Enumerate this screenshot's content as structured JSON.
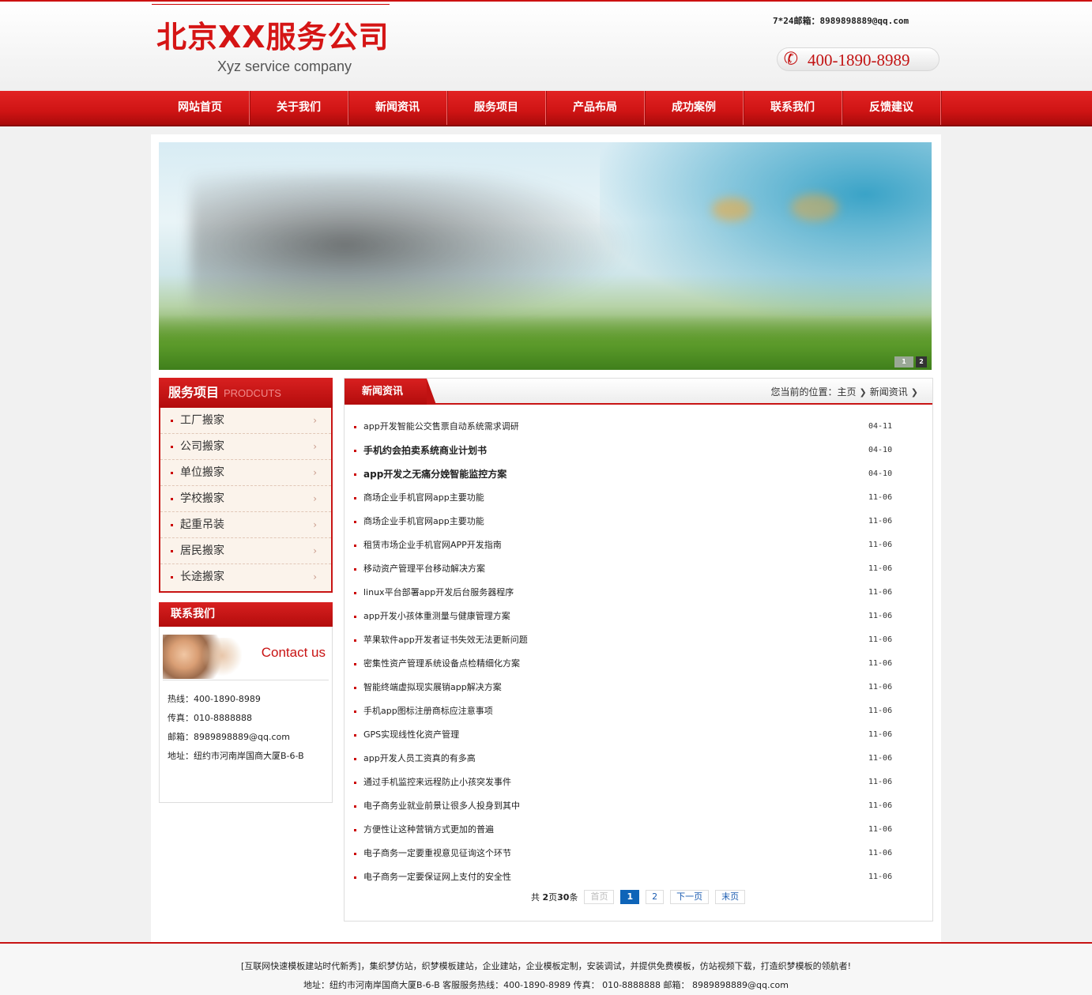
{
  "header": {
    "logo_cn": "北京XX服务公司",
    "logo_en": "Xyz service company",
    "top_email": "7*24邮箱：8989898889@qq.com",
    "phone": "400-1890-8989"
  },
  "nav": {
    "items": [
      "网站首页",
      "关于我们",
      "新闻资讯",
      "服务项目",
      "产品布局",
      "成功案例",
      "联系我们",
      "反馈建议"
    ]
  },
  "banner": {
    "dots": [
      "1",
      "2"
    ]
  },
  "sidebar": {
    "title_cn": "服务项目",
    "title_en": "PRODCUTS",
    "items": [
      "工厂搬家",
      "公司搬家",
      "单位搬家",
      "学校搬家",
      "起重吊装",
      "居民搬家",
      "长途搬家"
    ]
  },
  "contact": {
    "title": "联系我们",
    "image_text": "Contact us",
    "lines": [
      "热线：400-1890-8989",
      "传真：010-8888888",
      "邮箱：8989898889@qq.com",
      "地址：纽约市河南岸国商大厦B-6-B"
    ]
  },
  "news": {
    "tab": "新闻资讯",
    "breadcrumb_prefix": "您当前的位置：",
    "breadcrumb_home": "主页",
    "breadcrumb_current": "新闻资讯",
    "items": [
      {
        "title": "app开发智能公交售票自动系统需求调研",
        "date": "04-11",
        "bold": false
      },
      {
        "title": "手机约会拍卖系统商业计划书",
        "date": "04-10",
        "bold": true
      },
      {
        "title": "app开发之无痛分娩智能监控方案",
        "date": "04-10",
        "bold": true
      },
      {
        "title": "商场企业手机官网app主要功能",
        "date": "11-06",
        "bold": false
      },
      {
        "title": "商场企业手机官网app主要功能",
        "date": "11-06",
        "bold": false
      },
      {
        "title": "租赁市场企业手机官网APP开发指南",
        "date": "11-06",
        "bold": false
      },
      {
        "title": "移动资产管理平台移动解决方案",
        "date": "11-06",
        "bold": false
      },
      {
        "title": "linux平台部署app开发后台服务器程序",
        "date": "11-06",
        "bold": false
      },
      {
        "title": "app开发小孩体重测量与健康管理方案",
        "date": "11-06",
        "bold": false
      },
      {
        "title": "苹果软件app开发者证书失效无法更新问题",
        "date": "11-06",
        "bold": false
      },
      {
        "title": "密集性资产管理系统设备点检精细化方案",
        "date": "11-06",
        "bold": false
      },
      {
        "title": "智能终端虚拟现实展销app解决方案",
        "date": "11-06",
        "bold": false
      },
      {
        "title": "手机app图标注册商标应注意事项",
        "date": "11-06",
        "bold": false
      },
      {
        "title": "GPS实现线性化资产管理",
        "date": "11-06",
        "bold": false
      },
      {
        "title": "app开发人员工资真的有多高",
        "date": "11-06",
        "bold": false
      },
      {
        "title": "通过手机监控来远程防止小孩突发事件",
        "date": "11-06",
        "bold": false
      },
      {
        "title": "电子商务业就业前景让很多人投身到其中",
        "date": "11-06",
        "bold": false
      },
      {
        "title": "方便性让这种营销方式更加的普遍",
        "date": "11-06",
        "bold": false
      },
      {
        "title": "电子商务一定要重视意见征询这个环节",
        "date": "11-06",
        "bold": false
      },
      {
        "title": "电子商务一定要保证网上支付的安全性",
        "date": "11-06",
        "bold": false
      }
    ]
  },
  "pager": {
    "total_prefix": "共 ",
    "total_pages": "2",
    "total_mid": "页",
    "total_count": "30",
    "total_suffix": "条",
    "first": "首页",
    "current": "1",
    "page2": "2",
    "next": "下一页",
    "last": "末页"
  },
  "footer": {
    "line1": "[互联网快速模板建站时代新秀]，集织梦仿站，织梦模板建站，企业建站，企业模板定制，安装调试，并提供免费模板，仿站视频下载，打造织梦模板的领航者!",
    "line2": "地址：纽约市河南岸国商大厦B-6-B 客服服务热线：400-1890-8989 传真： 010-8888888 邮箱： 8989898889@qq.com"
  },
  "colors": {
    "brand_red": "#d51515",
    "pager_blue": "#0e64b8"
  }
}
